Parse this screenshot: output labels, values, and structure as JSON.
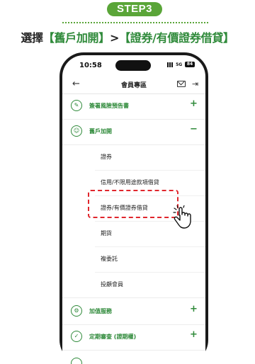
{
  "step_label": "STEP3",
  "instruction": {
    "prefix": "選擇",
    "b1_open": "【",
    "item1": "舊戶加開",
    "b1_close": "】",
    "separator": ">",
    "b2_open": "【",
    "item2": "證券/有價證券借貸",
    "b2_close": "】"
  },
  "status_bar": {
    "time": "10:58",
    "network": "5G",
    "battery": "84"
  },
  "header": {
    "title": "會員專區",
    "icons": [
      "back-arrow-icon",
      "mail-icon",
      "logout-icon"
    ]
  },
  "menu": [
    {
      "label": "簽署風險預告書",
      "toggle": "+",
      "icon": "document-sign-icon"
    },
    {
      "label": "舊戶加開",
      "toggle": "−",
      "icon": "user-icon"
    }
  ],
  "submenu": [
    {
      "label": "證券"
    },
    {
      "label": "信用/不限用途款項借貸"
    },
    {
      "label": "證券/有價證券借貸"
    },
    {
      "label": "期貨"
    },
    {
      "label": "複委託"
    },
    {
      "label": "投顧會員"
    }
  ],
  "menu_bottom": [
    {
      "label": "加值服務",
      "toggle": "+",
      "icon": "gear-icon"
    },
    {
      "label": "定期審查 (證期權)",
      "toggle": "+",
      "icon": "review-icon"
    }
  ],
  "colors": {
    "accent": "#2f8a3a",
    "step_pill": "#5aa538",
    "highlight": "#e0262c"
  }
}
